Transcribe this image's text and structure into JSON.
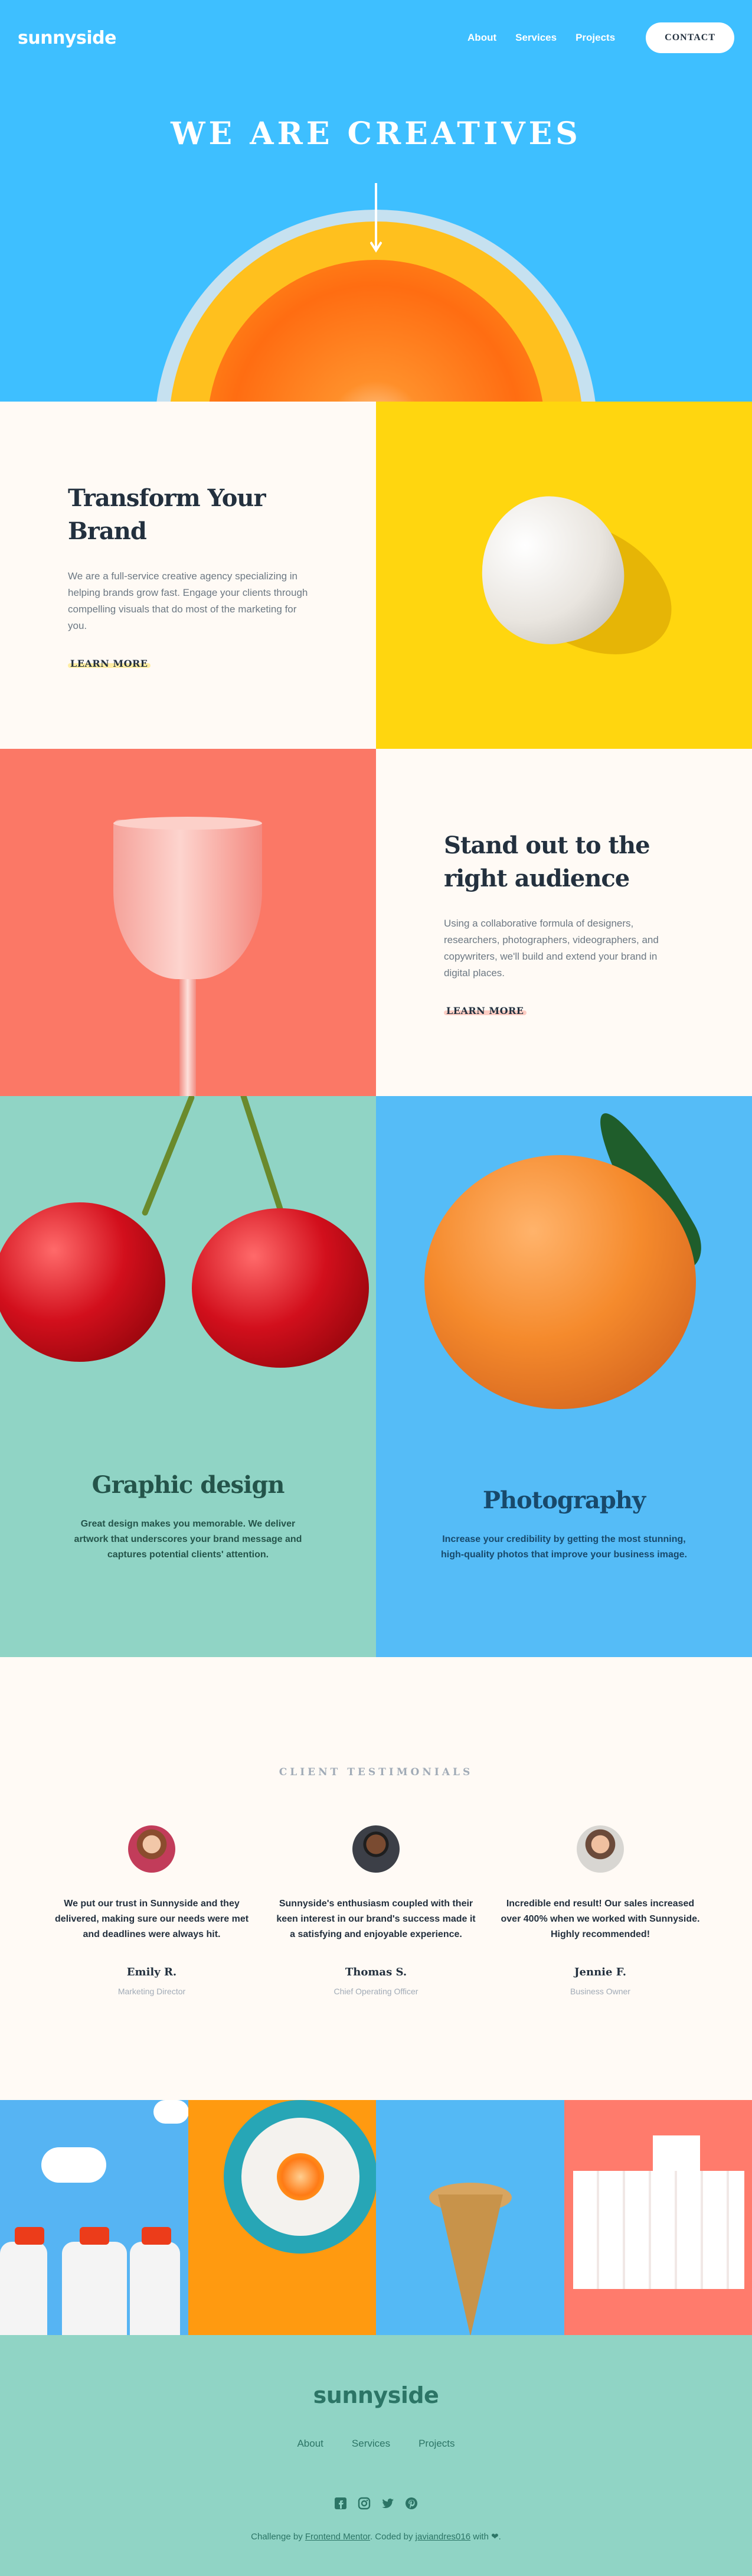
{
  "header": {
    "logo": "sunnyside",
    "nav": [
      {
        "label": "About"
      },
      {
        "label": "Services"
      },
      {
        "label": "Projects"
      }
    ],
    "contact_label": "CONTACT"
  },
  "hero": {
    "title": "WE ARE CREATIVES"
  },
  "transform": {
    "title": "Transform Your Brand",
    "body": "We are a full-service creative agency specializing in helping brands grow fast. Engage your clients through compelling visuals that do most of the marketing for you.",
    "cta": "LEARN MORE",
    "accent": "#ffd60f"
  },
  "standout": {
    "title": "Stand out to the right audience",
    "body": "Using a collaborative formula of designers, researchers, photographers, videographers, and copywriters, we'll build and extend your brand in digital places.",
    "cta": "LEARN MORE",
    "accent": "#fb7866"
  },
  "graphic": {
    "title": "Graphic design",
    "body": "Great design makes you memorable. We deliver artwork that underscores your brand message and captures potential clients' attention."
  },
  "photography": {
    "title": "Photography",
    "body": "Increase your credibility by getting the most stunning, high-quality photos that improve your business image."
  },
  "testimonials": {
    "label": "CLIENT TESTIMONIALS",
    "items": [
      {
        "quote": "We put our trust in Sunnyside and they delivered, making sure our needs were met and deadlines were always hit.",
        "name": "Emily R.",
        "role": "Marketing Director"
      },
      {
        "quote": "Sunnyside's enthusiasm coupled with their keen interest in our brand's success made it a satisfying and enjoyable experience.",
        "name": "Thomas S.",
        "role": "Chief Operating Officer"
      },
      {
        "quote": "Incredible end result! Our sales increased over 400% when we worked with Sunnyside. Highly recommended!",
        "name": "Jennie F.",
        "role": "Business Owner"
      }
    ]
  },
  "footer": {
    "logo": "sunnyside",
    "nav": [
      {
        "label": "About"
      },
      {
        "label": "Services"
      },
      {
        "label": "Projects"
      }
    ],
    "social_icons": [
      "facebook-icon",
      "instagram-icon",
      "twitter-icon",
      "pinterest-icon"
    ],
    "attrib_prefix": "Challenge by ",
    "attrib_link1": "Frontend Mentor",
    "attrib_mid": ". Coded by ",
    "attrib_link2": "javiandres016",
    "attrib_suffix": " with ",
    "heart": "❤",
    "attrib_end": "."
  },
  "colors": {
    "hero_bg": "#3ebfff",
    "dark_text": "#23303e",
    "footer_bg": "#90d4c5"
  }
}
